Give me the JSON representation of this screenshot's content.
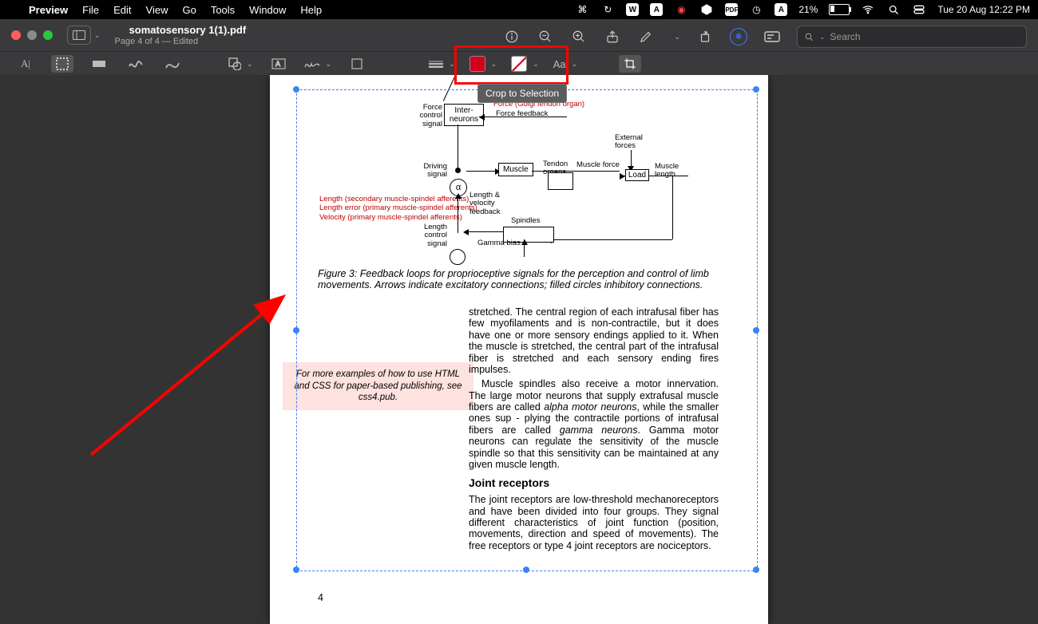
{
  "menubar": {
    "app": "Preview",
    "items": [
      "File",
      "Edit",
      "View",
      "Go",
      "Tools",
      "Window",
      "Help"
    ],
    "battery_pct": "21%",
    "clock": "Tue 20 Aug  12:22 PM"
  },
  "titlebar": {
    "doc_title": "somatosensory 1(1).pdf",
    "doc_sub": "Page 4 of 4 — Edited"
  },
  "search": {
    "placeholder": "Search"
  },
  "markup": {
    "font_label": "Aa"
  },
  "tooltip": {
    "crop": "Crop to Selection"
  },
  "diagram": {
    "force_control": "Force\ncontrol\nsignal",
    "inter": "Inter-\nneurons",
    "golgi": "Force (Golgi tendon organ)",
    "force_fb": "Force feedback",
    "driving": "Driving\nsignal",
    "muscle": "Muscle",
    "tendon": "Tendon\norgans",
    "muscle_force": "Muscle force",
    "external": "External\nforces",
    "load": "Load",
    "mlen": "Muscle\nlength",
    "aff1": "Length (secondary muscle-spindel afferents)",
    "aff2": "Length error (primary muscle-spindel afferents)",
    "aff3": "Velocity (primary muscle-spindel afferents)",
    "lv_fb": "Length &\nvelocity\nfeedback",
    "spindles": "Spindles",
    "gamma": "Gamma bias",
    "len_ctrl": "Length\ncontrol\nsignal",
    "alpha": "α"
  },
  "figcap": "Figure 3:  Feedback loops for proprioceptive signals for the perception and control of limb movements. Arrows indicate excitatory connections; filled circles inhibitory connections.",
  "pink": "For more examples of how to use HTML and CSS for paper-based publishing, see css4.pub.",
  "body": {
    "p1": "stretched. The central region of each intrafusal fiber has few myofilaments and is non-contractile, but it does have one or more sensory endings applied to it. When the muscle is stretched, the central part of the intrafusal fiber is stretched and each sensory ending fires impulses.",
    "p2a": "Muscle spindles also receive a motor innervation. The large motor neurons that supply extrafusal muscle fibers are called ",
    "p2i1": "alpha motor neurons",
    "p2b": ", while the smaller ones sup - plying the contractile portions of intrafusal fibers are called ",
    "p2i2": "gamma neurons",
    "p2c": ". Gamma motor neurons can regulate the sensitivity of the muscle spindle so that this sensitivity can be maintained at any given muscle length.",
    "h": "Joint receptors",
    "p3": "The joint receptors are low-threshold mechanoreceptors and have been divided into four groups. They signal different characteristics of joint function (position, movements, direction and speed of movements). The free receptors or type 4 joint receptors are nociceptors."
  },
  "pgnum": "4"
}
